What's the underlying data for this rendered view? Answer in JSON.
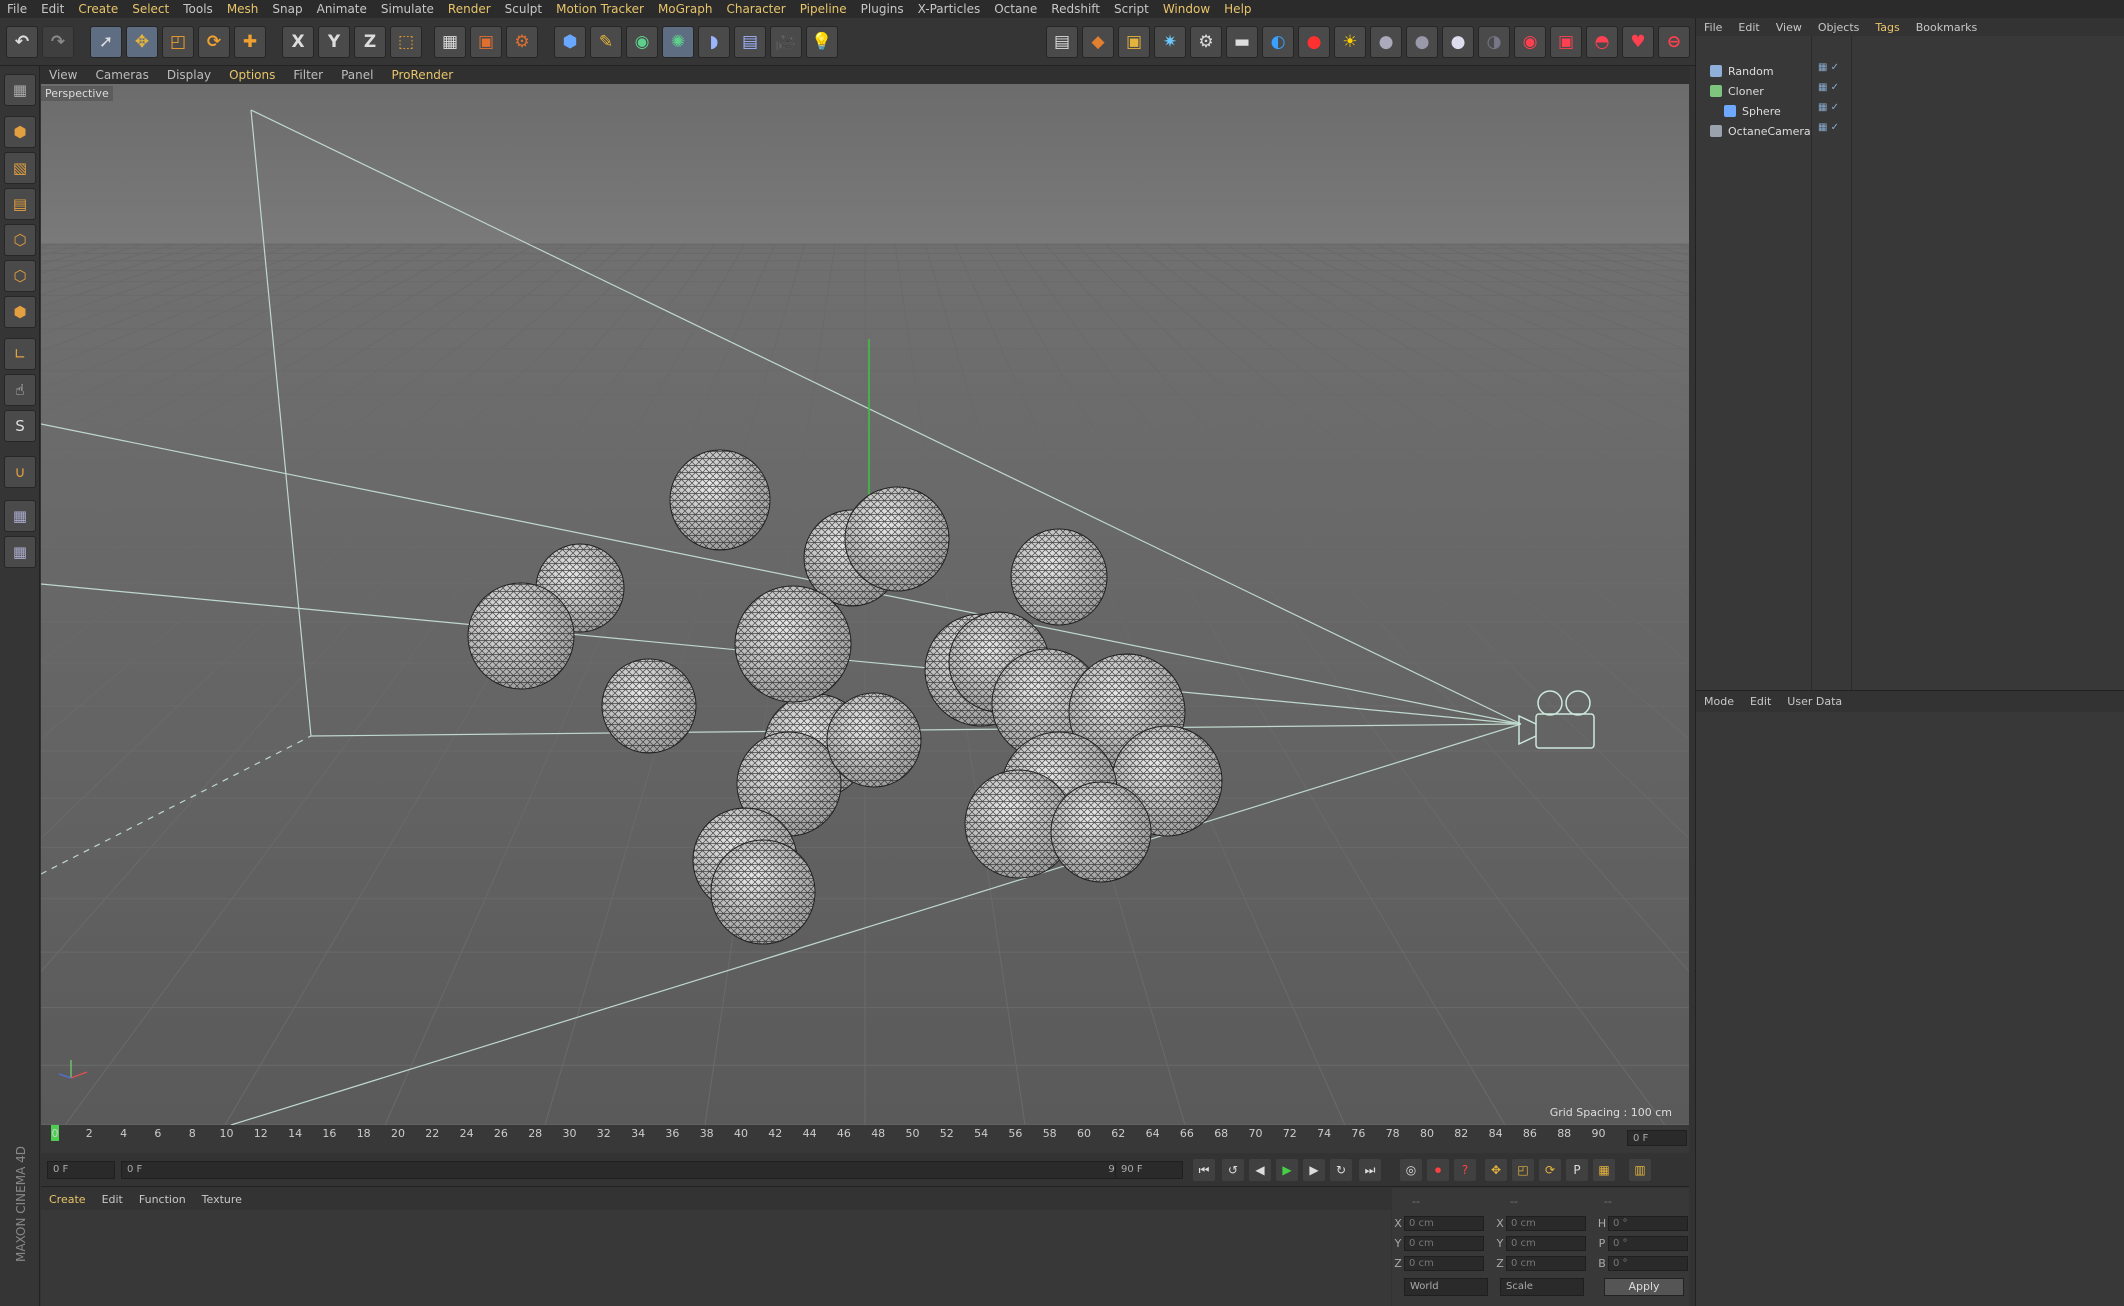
{
  "menu": [
    "File",
    "Edit",
    "Create",
    "Select",
    "Tools",
    "Mesh",
    "Snap",
    "Animate",
    "Simulate",
    "Render",
    "Sculpt",
    "Motion Tracker",
    "MoGraph",
    "Character",
    "Pipeline",
    "Plugins",
    "X-Particles",
    "Octane",
    "Redshift",
    "Script",
    "Window",
    "Help"
  ],
  "menu_highlight": [
    2,
    3,
    5,
    9,
    11,
    12,
    13,
    14,
    20,
    21
  ],
  "toolbar": {
    "axis_x": "X",
    "axis_y": "Y",
    "axis_z": "Z"
  },
  "viewport_menu": [
    "View",
    "Cameras",
    "Display",
    "Options",
    "Filter",
    "Panel",
    "ProRender"
  ],
  "viewport_menu_highlight": [
    3,
    6
  ],
  "viewport": {
    "label": "Perspective",
    "grid_spacing": "Grid Spacing : 100 cm"
  },
  "timeline": {
    "ticks": [
      "0",
      "2",
      "4",
      "6",
      "8",
      "10",
      "12",
      "14",
      "16",
      "18",
      "20",
      "22",
      "24",
      "26",
      "28",
      "30",
      "32",
      "34",
      "36",
      "38",
      "40",
      "42",
      "44",
      "46",
      "48",
      "50",
      "52",
      "54",
      "56",
      "58",
      "60",
      "62",
      "64",
      "66",
      "68",
      "70",
      "72",
      "74",
      "76",
      "78",
      "80",
      "82",
      "84",
      "86",
      "88",
      "90"
    ],
    "current_frame": "0 F"
  },
  "playback": {
    "start": "0 F",
    "range_start": "0 F",
    "range_end": "90 F",
    "end": "90 F"
  },
  "material_manager": {
    "menu": [
      "Create",
      "Edit",
      "Function",
      "Texture"
    ]
  },
  "coordinates": {
    "header": [
      "--",
      "--",
      "--"
    ],
    "rows": [
      {
        "a": "X",
        "av": "0 cm",
        "b": "X",
        "bv": "0 cm",
        "c": "H",
        "cv": "0 °"
      },
      {
        "a": "Y",
        "av": "0 cm",
        "b": "Y",
        "bv": "0 cm",
        "c": "P",
        "cv": "0 °"
      },
      {
        "a": "Z",
        "av": "0 cm",
        "b": "Z",
        "bv": "0 cm",
        "c": "B",
        "cv": "0 °"
      }
    ],
    "world": "World",
    "scale": "Scale",
    "apply": "Apply"
  },
  "object_manager": {
    "menu": [
      "File",
      "Edit",
      "View",
      "Objects",
      "Tags",
      "Bookmarks"
    ],
    "objects": [
      {
        "name": "Random",
        "indent": 0,
        "color": "#8fb0d8"
      },
      {
        "name": "Cloner",
        "indent": 0,
        "color": "#7ec47e"
      },
      {
        "name": "Sphere",
        "indent": 1,
        "color": "#6ea8ff"
      },
      {
        "name": "OctaneCamera",
        "indent": 0,
        "color": "#9aa3ad"
      }
    ]
  },
  "attributes": {
    "menu": [
      "Mode",
      "Edit",
      "User Data"
    ]
  },
  "branding": "MAXON CINEMA 4D"
}
